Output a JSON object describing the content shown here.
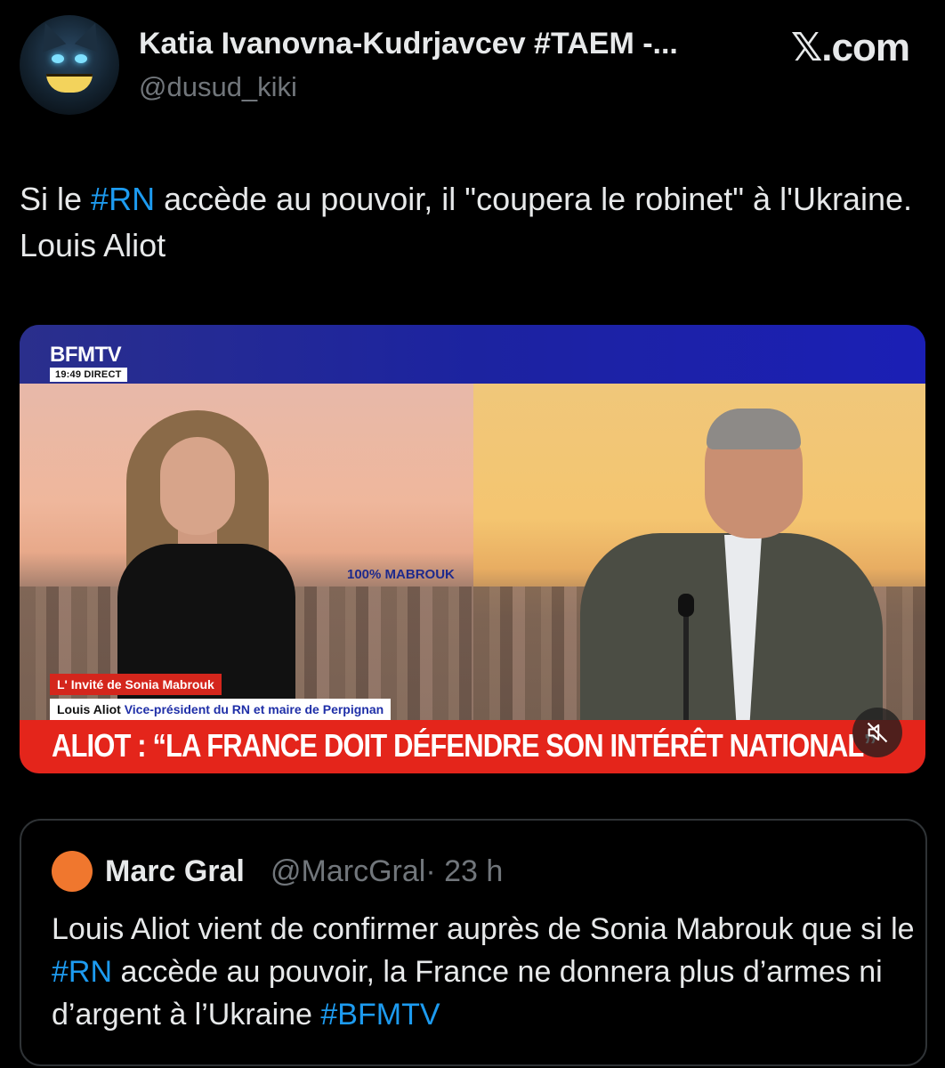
{
  "tweet": {
    "author_name": "Katia Ivanovna-Kudrjavcev #TAEM -...",
    "author_handle": "@dusud_kiki",
    "site_label": "𝕏.com",
    "text_part1": "Si le ",
    "hashtag": "#RN",
    "text_part2": " accède au pouvoir, il \"coupera le robinet\" à l'Ukraine. Louis Aliot"
  },
  "media": {
    "channel_logo": "BFMTV",
    "timestamp": "19:49 DIRECT",
    "show_tag": "100% MABROUK",
    "lower_third_1": "L' Invité de Sonia Mabrouk",
    "guest_name": "Louis Aliot ",
    "guest_role": "Vice-président du RN et maire de Perpignan",
    "headline": "ALIOT : “LA FRANCE DOIT DÉFENDRE SON INTÉRÊT NATIONAL”",
    "mute_icon": "muted-speaker-icon"
  },
  "quoted_tweet": {
    "author_name": "Marc Gral",
    "author_handle": "@MarcGral",
    "time": "· 23 h",
    "text_part1": "Louis Aliot vient de confirmer auprès de Sonia Mabrouk que si le ",
    "hashtag1": "#RN",
    "text_part2": " accède au pouvoir, la France ne donnera plus d’armes ni d’argent à l’Ukraine ",
    "hashtag2": "#BFMTV"
  },
  "colors": {
    "background": "#000000",
    "text": "#e7e9ea",
    "muted": "#71767b",
    "link": "#1d9bf0",
    "bfm_red": "#e4251b",
    "quote_avatar": "#f0772e"
  }
}
